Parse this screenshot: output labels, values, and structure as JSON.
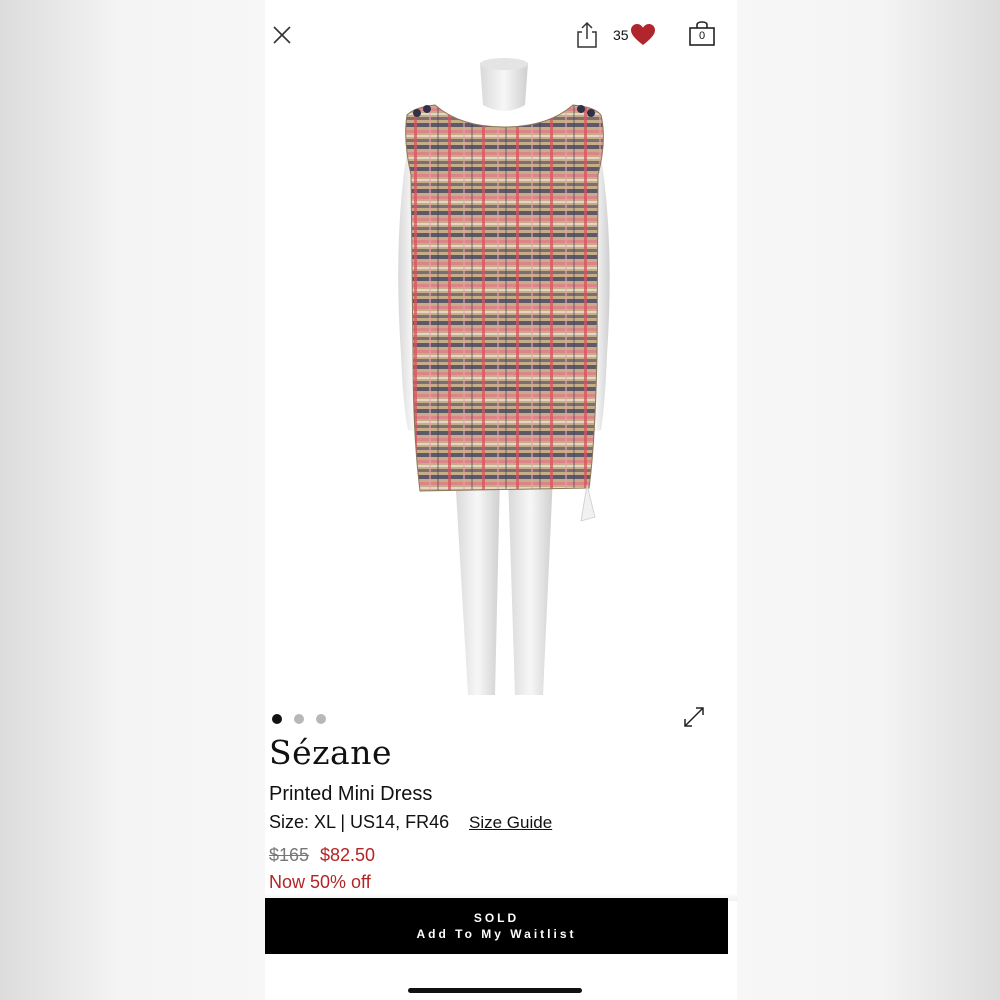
{
  "header": {
    "close_icon": "close-icon",
    "share_icon": "share-icon",
    "likes_count": "35",
    "heart_color": "#b0262c",
    "bag_count": "0"
  },
  "gallery": {
    "image_subject": "plaid tweed mini dress on mannequin",
    "dots": [
      true,
      false,
      false
    ],
    "expand_icon": "expand-icon"
  },
  "product": {
    "brand": "Sézane",
    "name": "Printed Mini Dress",
    "size": "Size: XL | US14, FR46",
    "size_guide_label": "Size Guide",
    "original_price": "$165",
    "sale_price": "$82.50",
    "discount": "Now 50% off",
    "sale_color": "#b32424"
  },
  "cta": {
    "status": "SOLD",
    "action": "Add To My Waitlist"
  }
}
